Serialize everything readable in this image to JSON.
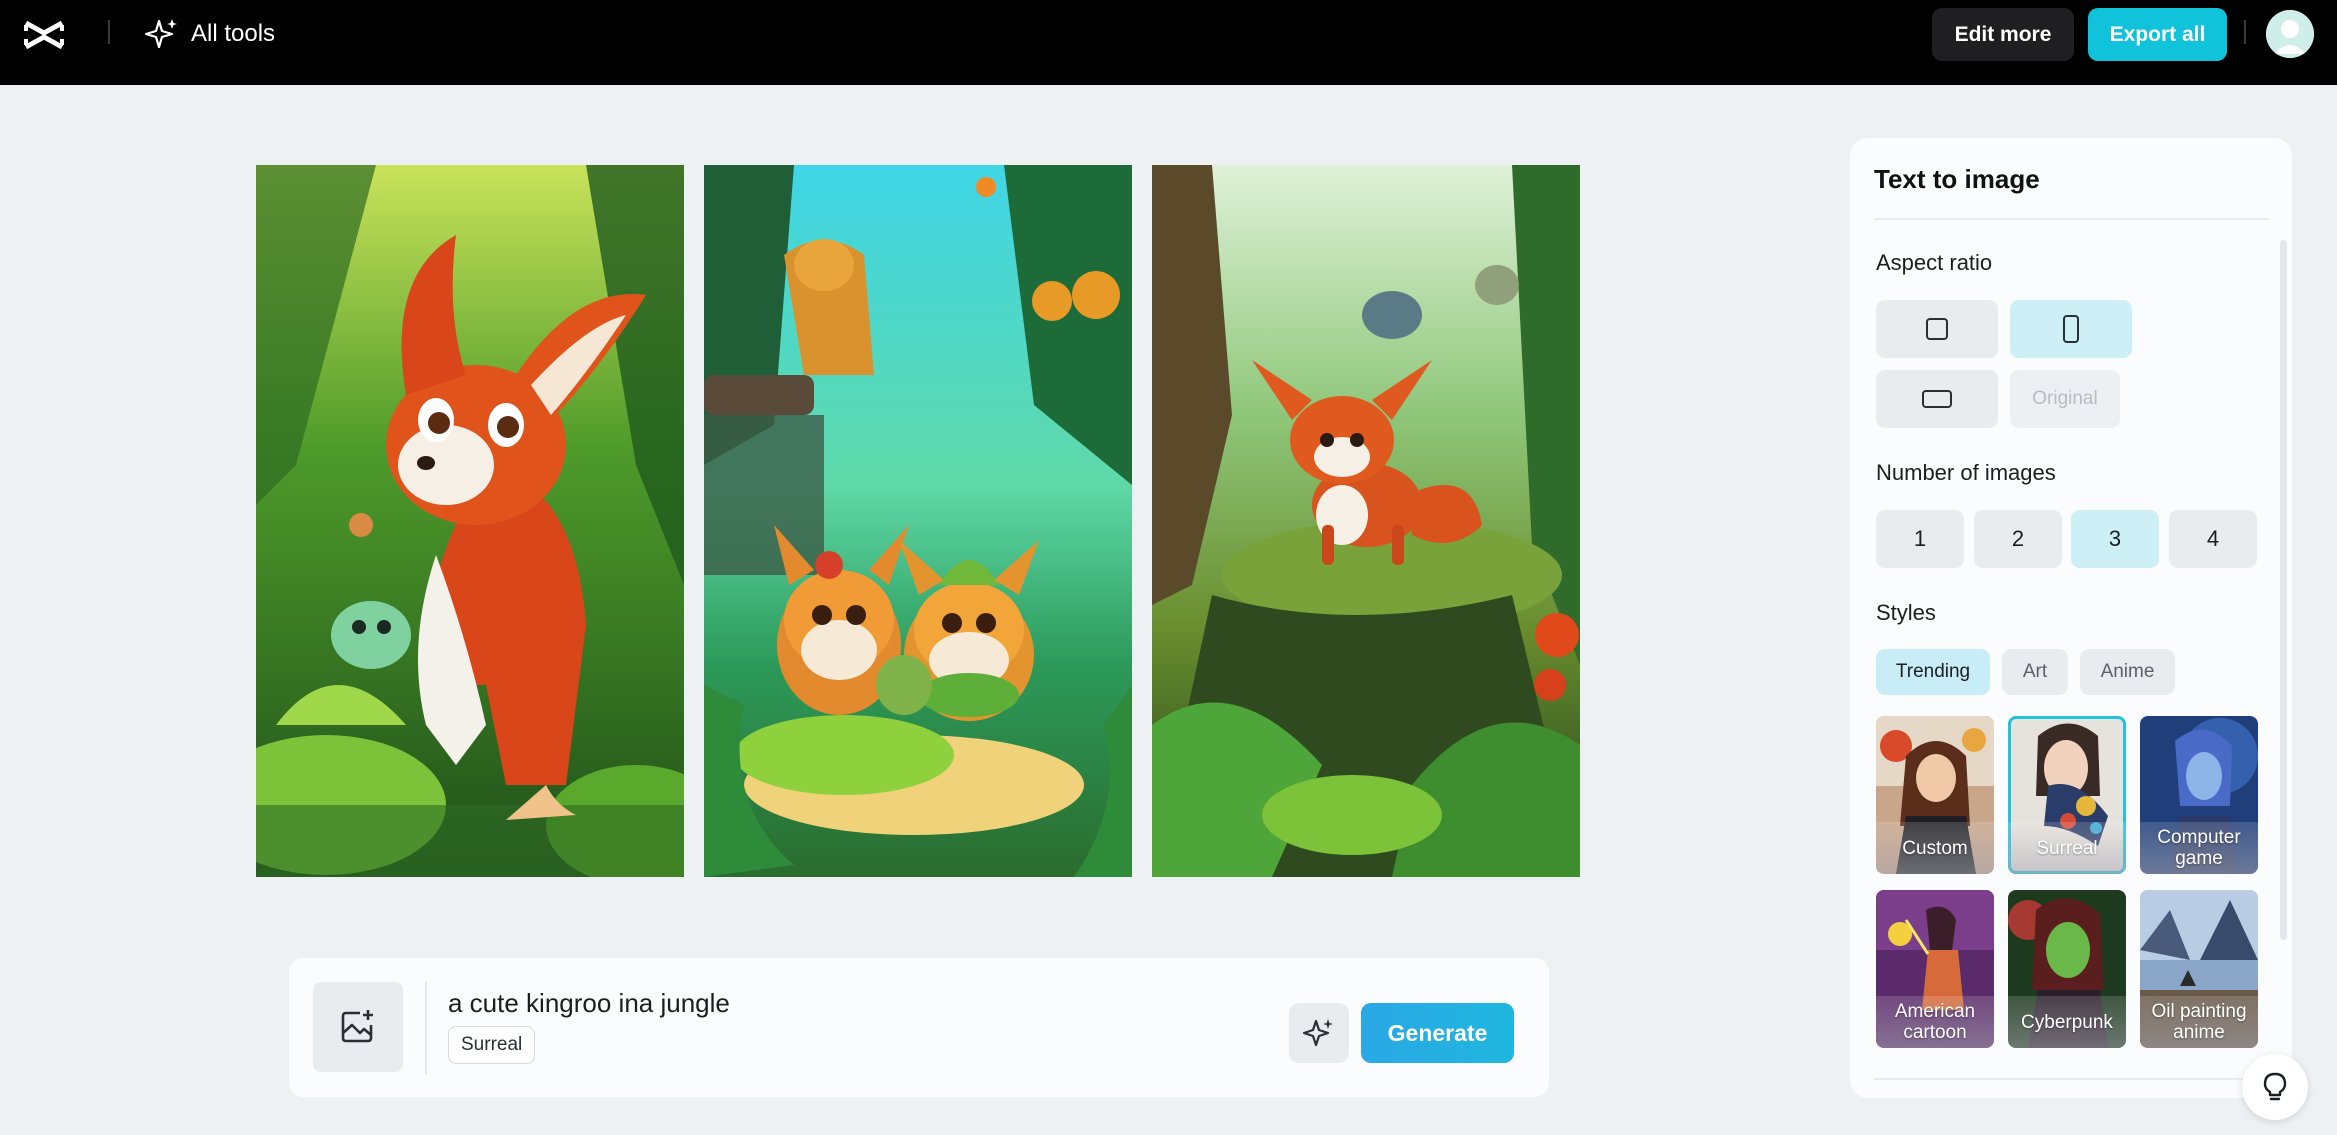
{
  "topbar": {
    "all_tools_label": "All tools",
    "edit_more_label": "Edit more",
    "export_all_label": "Export all",
    "accent_color": "#10c2da"
  },
  "generated_images": [
    {
      "alt": "cartoon fox in jungle"
    },
    {
      "alt": "two cartoon kittens in jungle"
    },
    {
      "alt": "cartoon fox on mossy ledge"
    }
  ],
  "prompt_bar": {
    "prompt_text": "a cute kingroo ina jungle",
    "style_tag": "Surreal",
    "generate_label": "Generate"
  },
  "panel": {
    "title": "Text to image",
    "aspect_ratio": {
      "label": "Aspect ratio",
      "options": [
        "square",
        "portrait",
        "landscape",
        "Original"
      ],
      "selected": "portrait"
    },
    "number_of_images": {
      "label": "Number of images",
      "options": [
        "1",
        "2",
        "3",
        "4"
      ],
      "selected": "3"
    },
    "styles": {
      "label": "Styles",
      "tabs": [
        "Trending",
        "Art",
        "Anime"
      ],
      "selected_tab": "Trending",
      "cards": [
        "Custom",
        "Surreal",
        "Computer game",
        "American cartoon",
        "Cyberpunk",
        "Oil painting anime"
      ],
      "selected_card": "Surreal"
    }
  }
}
